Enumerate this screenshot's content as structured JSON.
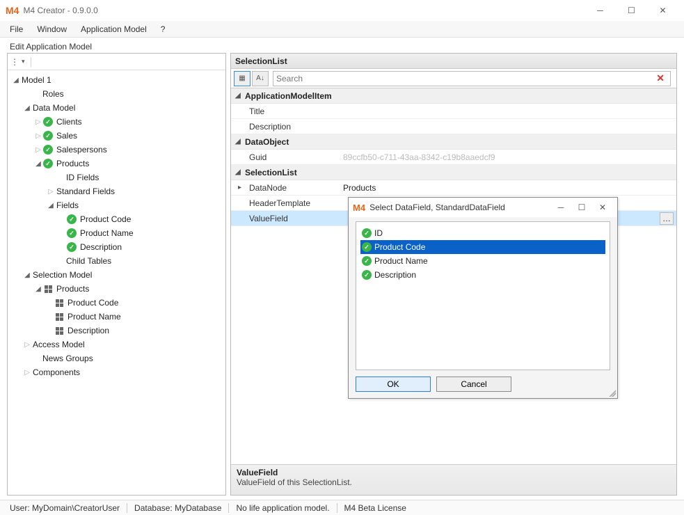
{
  "window": {
    "title": "M4 Creator - 0.9.0.0",
    "logo": "M4"
  },
  "menu": [
    "File",
    "Window",
    "Application Model",
    "?"
  ],
  "panel_title": "Edit Application Model",
  "tree": {
    "root": "Model 1",
    "roles": "Roles",
    "data_model": "Data Model",
    "clients": "Clients",
    "sales": "Sales",
    "salespersons": "Salespersons",
    "products": "Products",
    "id_fields": "ID Fields",
    "standard_fields": "Standard Fields",
    "fields": "Fields",
    "product_code": "Product Code",
    "product_name": "Product Name",
    "description": "Description",
    "child_tables": "Child Tables",
    "selection_model": "Selection Model",
    "sm_products": "Products",
    "sm_product_code": "Product Code",
    "sm_product_name": "Product Name",
    "sm_description": "Description",
    "access_model": "Access Model",
    "news_groups": "News Groups",
    "components": "Components"
  },
  "propgrid": {
    "header": "SelectionList",
    "search_placeholder": "Search",
    "cat_app": "ApplicationModelItem",
    "title_key": "Title",
    "desc_key": "Description",
    "cat_data": "DataObject",
    "guid_key": "Guid",
    "guid_val": "89ccfb50-c711-43aa-8342-c19b8aaedcf9",
    "cat_sel": "SelectionList",
    "datanode_key": "DataNode",
    "datanode_val": "Products",
    "header_tpl_key": "HeaderTemplate",
    "valuefield_key": "ValueField",
    "footer_title": "ValueField",
    "footer_desc": "ValueField of this SelectionList."
  },
  "dialog": {
    "title": "Select DataField, StandardDataField",
    "items": [
      "ID",
      "Product Code",
      "Product Name",
      "Description"
    ],
    "selected_index": 1,
    "ok": "OK",
    "cancel": "Cancel"
  },
  "status": {
    "user": "User: MyDomain\\CreatorUser",
    "db": "Database: MyDatabase",
    "life": "No life application model.",
    "license": "M4 Beta License"
  }
}
